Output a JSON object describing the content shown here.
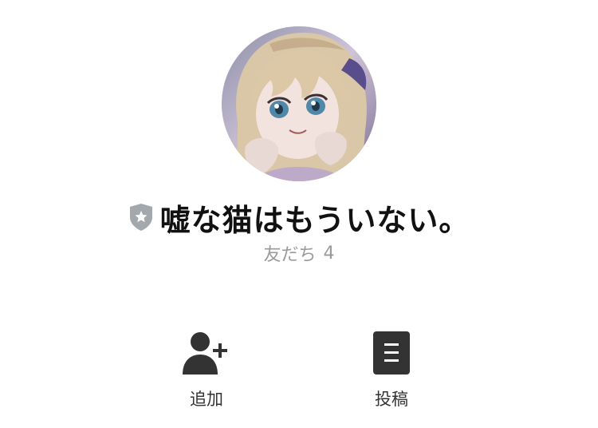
{
  "profile": {
    "name": "嘘な猫はもういない。",
    "friends_label": "友だち",
    "friends_count": "4",
    "badge_icon": "shield-star-icon",
    "avatar_icon": "anime-girl-portrait"
  },
  "actions": [
    {
      "label": "追加",
      "icon": "add-friend-icon"
    },
    {
      "label": "投稿",
      "icon": "post-icon"
    }
  ],
  "colors": {
    "text": "#111111",
    "muted": "#9a9a9a",
    "icon": "#333333",
    "badge": "#a3a8ad"
  }
}
